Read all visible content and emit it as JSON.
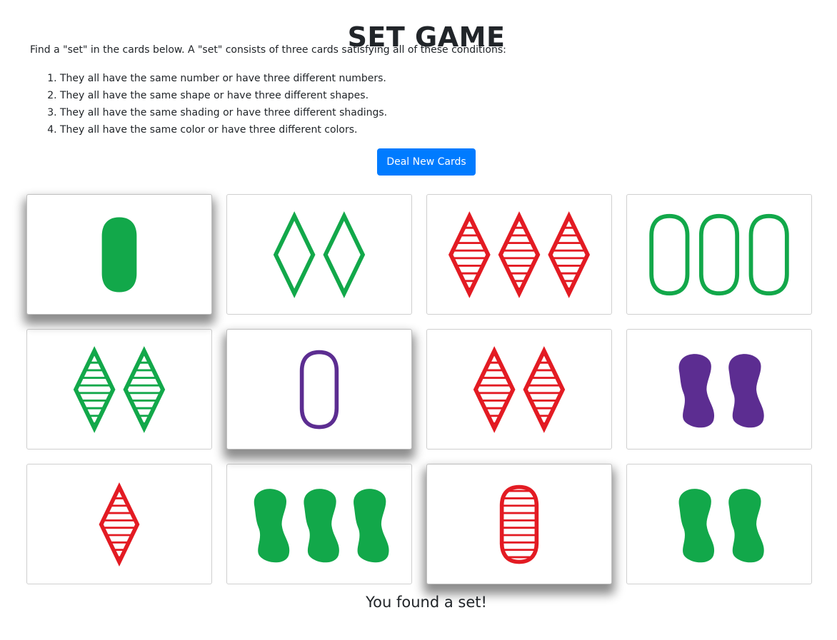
{
  "title": "SET GAME",
  "intro": "Find a \"set\" in the cards below. A \"set\" consists of three cards satisfying all of these conditions:",
  "rules": [
    "They all have the same number or have three different numbers.",
    "They all have the same shape or have three different shapes.",
    "They all have the same shading or have three different shadings.",
    "They all have the same color or have three different colors."
  ],
  "deal_button_label": "Deal New Cards",
  "message": "You found a set!",
  "colors": {
    "green": "#12a84a",
    "red": "#e31b23",
    "purple": "#5c2d91",
    "button": "#007bff"
  },
  "cards": [
    {
      "count": 1,
      "shape": "oval",
      "shading": "solid",
      "color": "green",
      "selected": true
    },
    {
      "count": 2,
      "shape": "diamond",
      "shading": "open",
      "color": "green",
      "selected": false
    },
    {
      "count": 3,
      "shape": "diamond",
      "shading": "striped",
      "color": "red",
      "selected": false
    },
    {
      "count": 3,
      "shape": "oval",
      "shading": "open",
      "color": "green",
      "selected": false
    },
    {
      "count": 2,
      "shape": "diamond",
      "shading": "striped",
      "color": "green",
      "selected": false
    },
    {
      "count": 1,
      "shape": "oval",
      "shading": "open",
      "color": "purple",
      "selected": true
    },
    {
      "count": 2,
      "shape": "diamond",
      "shading": "striped",
      "color": "red",
      "selected": false
    },
    {
      "count": 2,
      "shape": "squiggle",
      "shading": "solid",
      "color": "purple",
      "selected": false
    },
    {
      "count": 1,
      "shape": "diamond",
      "shading": "striped",
      "color": "red",
      "selected": false
    },
    {
      "count": 3,
      "shape": "squiggle",
      "shading": "solid",
      "color": "green",
      "selected": false
    },
    {
      "count": 1,
      "shape": "oval",
      "shading": "striped",
      "color": "red",
      "selected": true
    },
    {
      "count": 2,
      "shape": "squiggle",
      "shading": "solid",
      "color": "green",
      "selected": false
    }
  ]
}
